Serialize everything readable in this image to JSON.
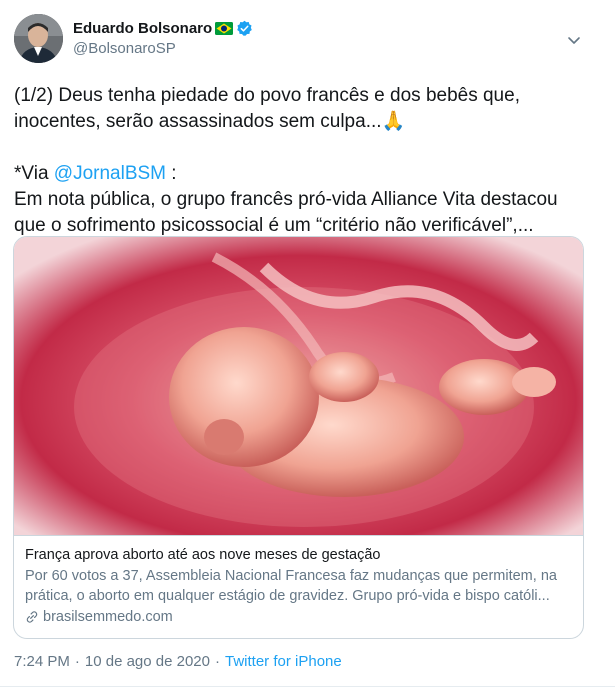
{
  "author": {
    "display_name": "Eduardo Bolsonaro",
    "handle": "@BolsonaroSP",
    "flag_icon": "brazil-flag-icon",
    "verified_icon": "verified-badge-icon"
  },
  "tweet": {
    "line1": "(1/2) Deus tenha piedade do povo francês e dos bebês que, inocentes, serão assassinados sem culpa...",
    "emoji": "🙏",
    "via_prefix": "*Via ",
    "mention": "@JornalBSM",
    "via_suffix": " :",
    "line2": "Em nota pública, o grupo francês pró-vida Alliance Vita destacou que o sofrimento psicossocial é um “critério não verificável”,..."
  },
  "card": {
    "title": "França aprova aborto até aos nove meses de gestação",
    "description": "Por 60 votos a 37, Assembleia Nacional Francesa faz mudanças que permitem, na prática, o aborto em qualquer estágio de gravidez. Grupo pró-vida e bispo católi...",
    "domain": "brasilsemmedo.com"
  },
  "footer": {
    "time": "7:24 PM",
    "separator": "·",
    "date": "10 de ago de 2020",
    "source": "Twitter for iPhone"
  },
  "colors": {
    "link": "#1da1f2",
    "secondary_text": "#657786",
    "border": "#ccd6dd"
  }
}
